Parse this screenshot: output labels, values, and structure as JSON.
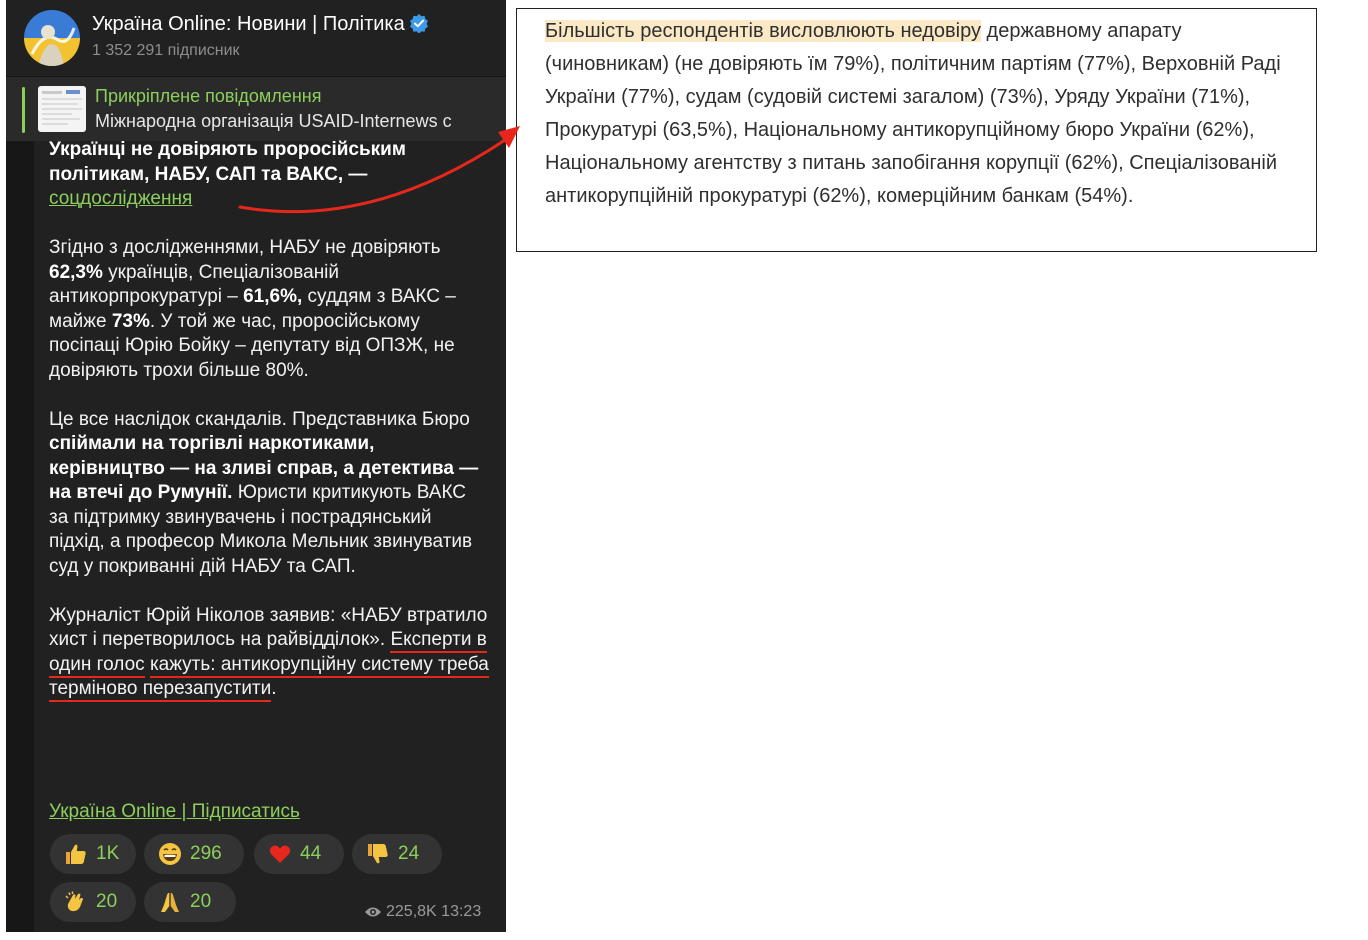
{
  "channel": {
    "title": "Україна Online: Новини | Політика",
    "subscribers": "1 352 291 підписник"
  },
  "pinned": {
    "title": "Прикріплене повідомлення",
    "text": "Міжнародна організація USAID-Internews с"
  },
  "message": {
    "headline_1": "Українці не довіряють проросійським політикам, НАБУ, САП та ВАКС, — ",
    "headline_link": "соцдослідження",
    "p1_a": "Згідно з дослідженнями, НАБУ не довіряють ",
    "p1_b": "62,3%",
    "p1_c": " українців, Спеціалізованій антикорпрокуратурі – ",
    "p1_d": "61,6%,",
    "p1_e": " суддям з ВАКС – майже ",
    "p1_f": "73%",
    "p1_g": ". У той же час, проросійському посіпаці Юрію Бойку – депутату від ОПЗЖ, не довіряють трохи більше 80%.",
    "p2_a": "Це все наслідок скандалів. Представника Бюро ",
    "p2_b": "спіймали на торгівлі наркотиками, керівництво — на зливі справ, а детектива — на втечі до Румунії.",
    "p2_c": " Юристи критикують ВАКС за підтримку звинувачень і пострадянський підхід, а професор Микола Мельник звинуватив суд у покриванні дій НАБУ та САП.",
    "p3_a": "Журналіст Юрій Ніколов заявив: «НАБУ втратило хист і перетворилось на райвідділок». ",
    "p3_u1": "Експерти в один голос",
    "p3_u2": "кажуть: антикорупційну систему треба",
    "p3_u3": "терміново перезапустити",
    "p3_end": ".",
    "subscribe_link": "Україна Online | Підписатись"
  },
  "reactions": [
    {
      "icon": "thumbs-up-icon",
      "count": "1K"
    },
    {
      "icon": "grinning-face-icon",
      "count": "296"
    },
    {
      "icon": "heart-icon",
      "count": "44"
    },
    {
      "icon": "thumbs-down-icon",
      "count": "24"
    },
    {
      "icon": "clapping-hands-icon",
      "count": "20"
    },
    {
      "icon": "folded-hands-icon",
      "count": "20"
    }
  ],
  "meta": {
    "views": "225,8K",
    "time": "13:23"
  },
  "quote": {
    "highlighted": "Більшість респондентів висловлюють недовіру",
    "rest": " державному апарату (чиновникам) (не довіряють їм 79%), політичним партіям (77%), Верховній Раді України (77%), судам (судовій системі загалом) (73%), Уряду України (71%), Прокуратурі (63,5%), Національному антикорупційному бюро України (62%), Національному агентству з питань запобігання корупції (62%), Спеціалізованій антикорупційній прокуратурі (62%), комерційним банкам (54%)."
  },
  "colors": {
    "accent_green": "#8ccf5c",
    "annotation_red": "#e8271c",
    "highlight": "#fbe9c6",
    "panel_bg": "#212121"
  }
}
